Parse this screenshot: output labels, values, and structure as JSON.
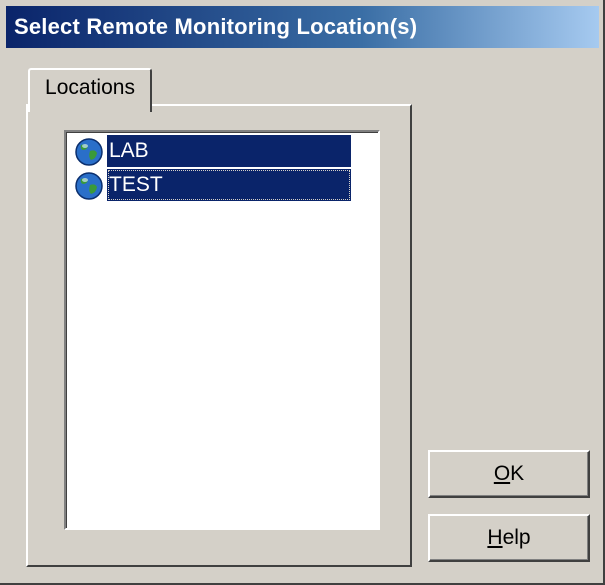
{
  "window": {
    "title": "Select Remote Monitoring Location(s)"
  },
  "tabs": [
    {
      "label": "Locations",
      "active": true
    }
  ],
  "locations_list": {
    "items": [
      {
        "label": "LAB",
        "icon": "globe-icon",
        "selected": true
      },
      {
        "label": "TEST",
        "icon": "globe-icon",
        "selected": true,
        "focused": true
      }
    ]
  },
  "buttons": {
    "ok": {
      "mnemonic": "O",
      "rest": "K"
    },
    "help": {
      "mnemonic": "H",
      "rest": "elp"
    }
  },
  "colors": {
    "selection": "#0a246a",
    "face": "#d4d0c8",
    "title_start": "#0a246a",
    "title_end": "#a6caf0"
  }
}
